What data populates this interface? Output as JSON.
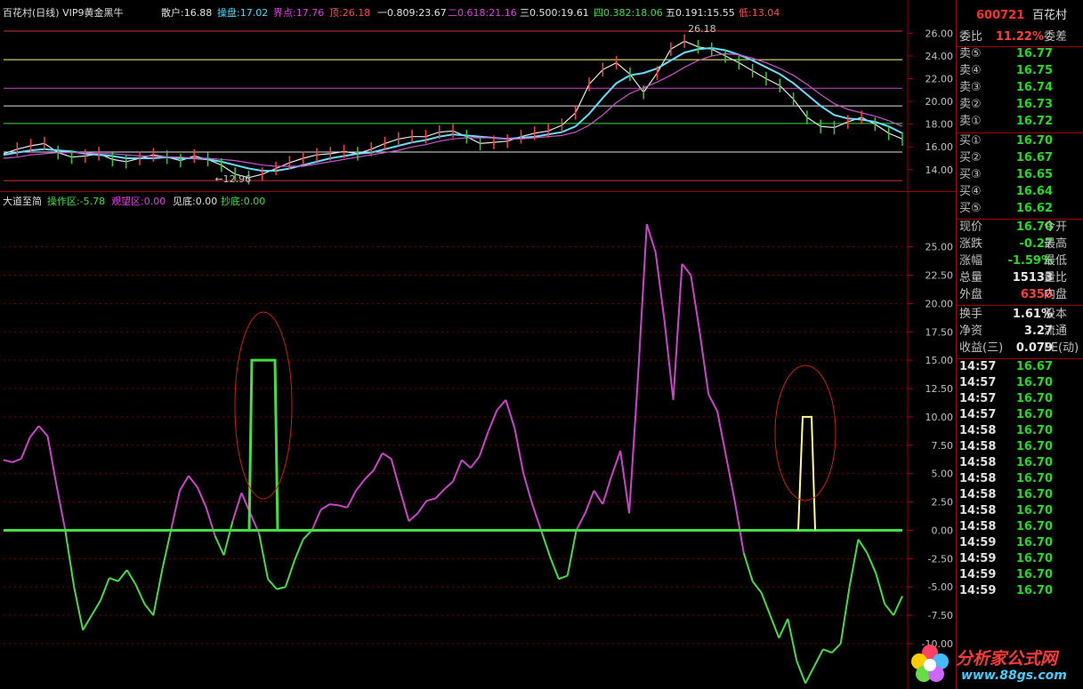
{
  "topbar": {
    "title": "百花村(日线) VIP9黄金黑牛",
    "sanhu": "散户:16.88",
    "caopan": "操盘:17.02",
    "jiedian": "界点:17.76",
    "ding": "顶:26.18",
    "fib1": "一0.809:23.67",
    "fib2": "二0.618:21.16",
    "fib3": "三0.500:19.61",
    "fib4": "四0.382:18.06",
    "fib5": "五0.191:15.55",
    "di": "低:13.04"
  },
  "indicator_bar": {
    "name": "大道至简",
    "caozuo": "操作区:-5.78",
    "guanwang": "观望区:0.00",
    "jiandi": "见底:0.00",
    "chaodi": "抄底:0.00"
  },
  "price_axis": [
    "26.00",
    "24.00",
    "22.00",
    "20.00",
    "18.00",
    "16.00",
    "14.00"
  ],
  "ind_axis": [
    "25.00",
    "22.50",
    "20.00",
    "17.50",
    "15.00",
    "12.50",
    "10.00",
    "7.50",
    "5.00",
    "2.50",
    "0.00",
    "-2.50",
    "-5.00",
    "-7.50",
    "-10.00"
  ],
  "annotations": {
    "high": "26.18",
    "low": "12.96"
  },
  "panel": {
    "code": "600721",
    "name": "百花村",
    "weibi_label": "委比",
    "weibi_value": "11.22%",
    "weicha_label": "委差",
    "asks": [
      {
        "label": "卖⑤",
        "price": "16.77"
      },
      {
        "label": "卖④",
        "price": "16.75"
      },
      {
        "label": "卖③",
        "price": "16.74"
      },
      {
        "label": "卖②",
        "price": "16.73"
      },
      {
        "label": "卖①",
        "price": "16.72"
      }
    ],
    "bids": [
      {
        "label": "买①",
        "price": "16.70"
      },
      {
        "label": "买②",
        "price": "16.67"
      },
      {
        "label": "买③",
        "price": "16.65"
      },
      {
        "label": "买④",
        "price": "16.64"
      },
      {
        "label": "买⑤",
        "price": "16.62"
      }
    ],
    "quote": [
      {
        "label": "现价",
        "value": "16.70",
        "label2": "今开",
        "color": "green"
      },
      {
        "label": "涨跌",
        "value": "-0.27",
        "label2": "最高",
        "color": "green"
      },
      {
        "label": "涨幅",
        "value": "-1.59%",
        "label2": "最低",
        "color": "green"
      },
      {
        "label": "总量",
        "value": "15133",
        "label2": "量比",
        "color": "white"
      },
      {
        "label": "外盘",
        "value": "6350",
        "label2": "内盘",
        "color": "red"
      }
    ],
    "stats": [
      {
        "label": "换手",
        "value": "1.61%",
        "label2": "股本"
      },
      {
        "label": "净资",
        "value": "3.27",
        "label2": "流通"
      },
      {
        "label": "收益(三)",
        "value": "0.079",
        "label2": "PE(动)"
      }
    ],
    "ticks": [
      {
        "time": "14:57",
        "price": "16.67"
      },
      {
        "time": "14:57",
        "price": "16.70"
      },
      {
        "time": "14:57",
        "price": "16.70"
      },
      {
        "time": "14:57",
        "price": "16.70"
      },
      {
        "time": "14:58",
        "price": "16.70"
      },
      {
        "time": "14:58",
        "price": "16.70"
      },
      {
        "time": "14:58",
        "price": "16.70"
      },
      {
        "time": "14:58",
        "price": "16.70"
      },
      {
        "time": "14:58",
        "price": "16.70"
      },
      {
        "time": "14:58",
        "price": "16.70"
      },
      {
        "time": "14:58",
        "price": "16.70"
      },
      {
        "time": "14:59",
        "price": "16.70"
      },
      {
        "time": "14:59",
        "price": "16.70"
      },
      {
        "time": "14:59",
        "price": "16.70"
      },
      {
        "time": "14:59",
        "price": "16.70"
      }
    ]
  },
  "logo": {
    "name": "分析家公式网",
    "url": "www.88gs.com"
  },
  "colors": {
    "magenta": "#cc44cc",
    "green": "#44dd44",
    "yellow": "#ffff88",
    "fib_yellow": "#ffff80",
    "fib_magenta": "#cc44cc",
    "fib_white": "#e0e0e0",
    "fib_green": "#44dd44",
    "border_red": "#a00000"
  },
  "chart_data": [
    {
      "type": "line",
      "title": "百花村(日线) VIP9黄金黑牛",
      "ylim": [
        12.5,
        27.2
      ],
      "levels": [
        {
          "name": "顶",
          "value": 26.18
        },
        {
          "name": "一0.809",
          "value": 23.67
        },
        {
          "name": "二0.618",
          "value": 21.16
        },
        {
          "name": "三0.500",
          "value": 19.61
        },
        {
          "name": "四0.382",
          "value": 18.06
        },
        {
          "name": "五0.191",
          "value": 15.55
        },
        {
          "name": "低",
          "value": 13.04
        }
      ],
      "series": [
        {
          "name": "价格",
          "values": [
            15.4,
            15.8,
            16.1,
            16.3,
            15.5,
            15.1,
            15.2,
            15.4,
            14.9,
            14.7,
            15.0,
            15.3,
            15.1,
            14.8,
            15.2,
            14.9,
            14.4,
            13.6,
            13.3,
            13.6,
            14.1,
            14.6,
            15.0,
            15.3,
            15.4,
            15.6,
            15.4,
            15.8,
            16.3,
            16.7,
            16.9,
            16.9,
            17.3,
            17.4,
            16.9,
            16.3,
            16.4,
            16.5,
            16.9,
            17.2,
            17.4,
            17.9,
            19.0,
            21.5,
            22.8,
            23.4,
            22.4,
            20.8,
            22.5,
            24.6,
            25.3,
            24.8,
            24.6,
            24.0,
            23.4,
            22.7,
            22.0,
            21.4,
            20.2,
            18.6,
            17.8,
            17.7,
            18.2,
            18.6,
            18.0,
            17.2,
            16.7
          ]
        },
        {
          "name": "均线1",
          "values": [
            15.3,
            15.5,
            15.7,
            15.8,
            15.7,
            15.6,
            15.4,
            15.3,
            15.2,
            15.0,
            15.0,
            15.0,
            15.1,
            15.0,
            15.0,
            14.9,
            14.7,
            14.4,
            14.1,
            13.9,
            13.9,
            14.1,
            14.4,
            14.7,
            15.0,
            15.2,
            15.4,
            15.5,
            15.8,
            16.1,
            16.4,
            16.6,
            16.9,
            17.1,
            17.0,
            16.9,
            16.8,
            16.7,
            16.8,
            16.9,
            17.1,
            17.3,
            17.8,
            18.9,
            20.3,
            21.6,
            22.3,
            22.5,
            22.9,
            23.6,
            24.3,
            24.6,
            24.7,
            24.5,
            24.1,
            23.6,
            23.0,
            22.4,
            21.6,
            20.6,
            19.6,
            18.8,
            18.5,
            18.4,
            18.2,
            17.8,
            17.2
          ]
        },
        {
          "name": "均线2",
          "values": [
            15.0,
            15.1,
            15.3,
            15.4,
            15.5,
            15.5,
            15.5,
            15.4,
            15.4,
            15.3,
            15.2,
            15.2,
            15.1,
            15.1,
            15.0,
            15.0,
            14.9,
            14.8,
            14.6,
            14.4,
            14.3,
            14.3,
            14.3,
            14.5,
            14.7,
            14.9,
            15.1,
            15.3,
            15.5,
            15.7,
            16.0,
            16.2,
            16.5,
            16.7,
            16.8,
            16.8,
            16.8,
            16.7,
            16.7,
            16.8,
            16.9,
            17.0,
            17.3,
            17.9,
            18.8,
            19.9,
            20.7,
            21.2,
            21.7,
            22.3,
            23.0,
            23.6,
            24.0,
            24.2,
            24.1,
            23.8,
            23.4,
            22.9,
            22.3,
            21.5,
            20.6,
            19.8,
            19.3,
            19.0,
            18.7,
            18.3,
            17.8
          ]
        }
      ]
    },
    {
      "type": "line",
      "title": "大道至简",
      "ylim": [
        -14.0,
        28.5
      ],
      "series": [
        {
          "name": "操作区",
          "values": [
            6.2,
            6.0,
            6.3,
            8.2,
            9.2,
            8.3,
            4.0,
            0.0,
            -5.0,
            -8.8,
            -7.5,
            -6.2,
            -4.2,
            -4.5,
            -3.5,
            -4.8,
            -6.5,
            -7.5,
            -3.5,
            0.0,
            3.5,
            4.8,
            3.8,
            2.0,
            -0.5,
            -2.2,
            0.8,
            3.3,
            1.5,
            -0.3,
            -4.3,
            -5.2,
            -5.0,
            -2.7,
            -0.8,
            0.0,
            1.8,
            2.3,
            2.2,
            2.0,
            3.5,
            4.5,
            5.3,
            6.8,
            6.3,
            3.5,
            0.8,
            1.5,
            2.6,
            2.8,
            3.6,
            4.3,
            6.2,
            5.5,
            6.5,
            8.7,
            10.6,
            11.5,
            9.0,
            5.0,
            2.3,
            0.0,
            -2.3,
            -4.3,
            -4.0,
            0.0,
            1.5,
            3.5,
            2.3,
            4.8,
            7.0,
            1.5,
            13.5,
            27.0,
            24.5,
            18.5,
            11.5,
            23.5,
            22.5,
            17.5,
            12.0,
            10.5,
            6.5,
            2.5,
            -2.0,
            -4.5,
            -5.5,
            -7.5,
            -9.5,
            -7.8,
            -11.5,
            -13.5,
            -12.0,
            -10.5,
            -10.8,
            -10.0,
            -5.0,
            -0.8,
            -2.0,
            -3.8,
            -6.5,
            -7.5,
            -5.8
          ]
        },
        {
          "name": "观望区",
          "values": [
            0.0,
            15.0,
            15.0,
            0.0
          ]
        },
        {
          "name": "见底",
          "values": [
            0.0,
            10.0,
            10.0,
            0.0
          ]
        },
        {
          "name": "抄底",
          "values": [
            0.0
          ]
        }
      ]
    }
  ]
}
